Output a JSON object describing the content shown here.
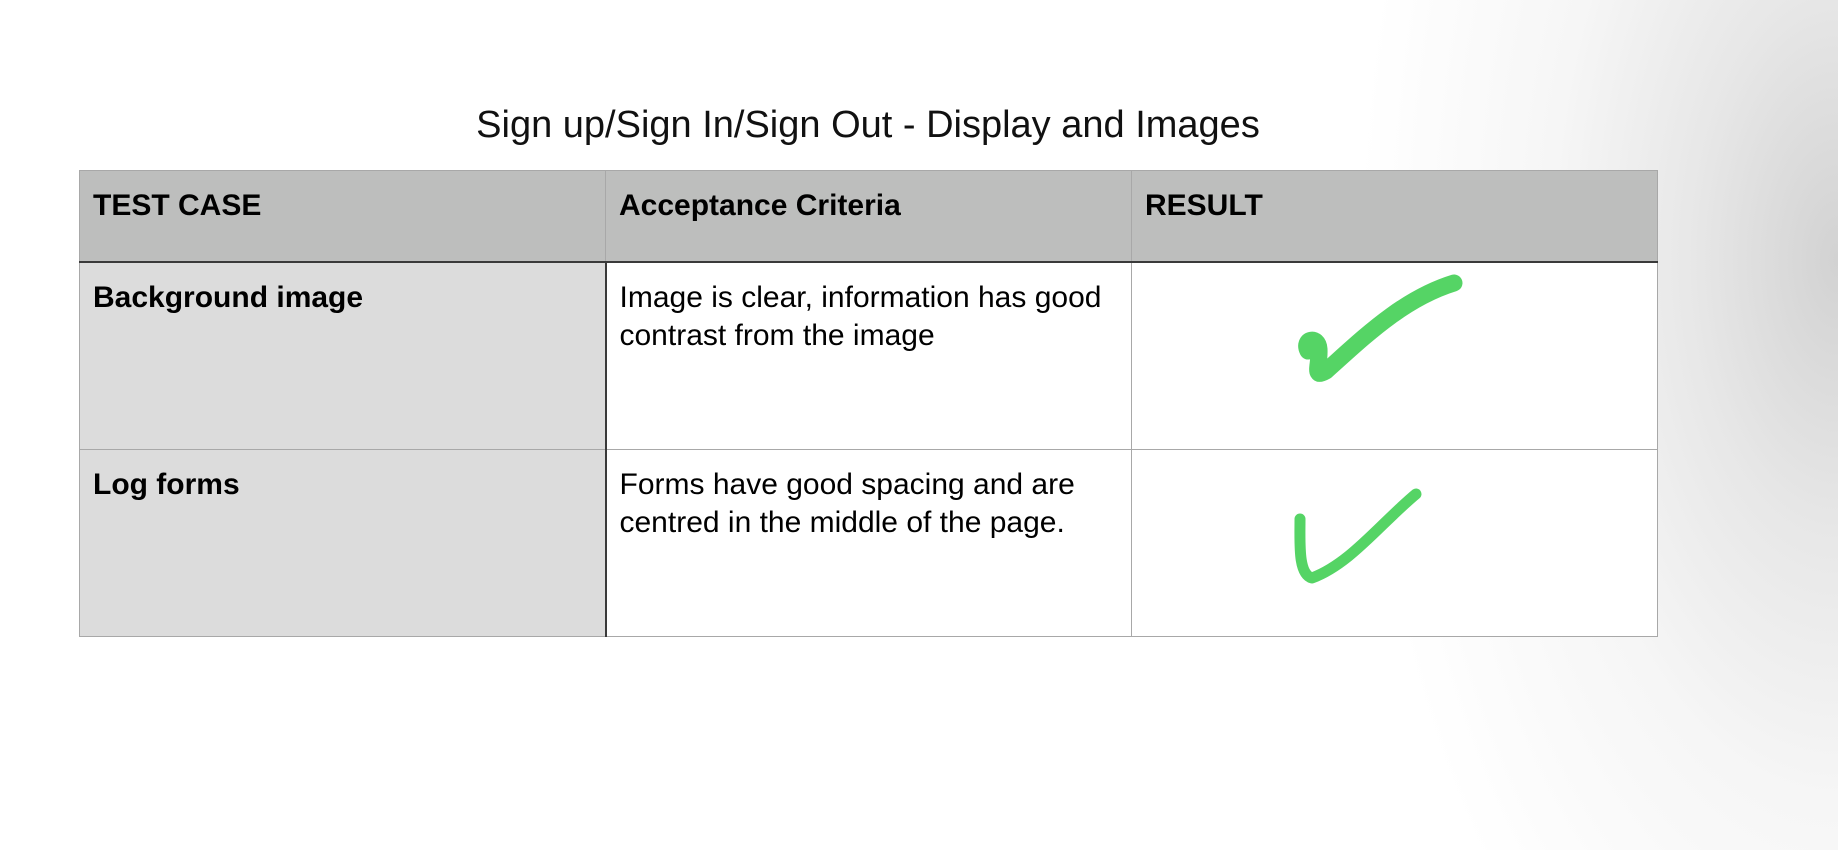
{
  "slide": {
    "title": "Sign up/Sign In/Sign Out - Display and Images"
  },
  "table": {
    "headers": [
      "TEST CASE",
      "Acceptance Criteria",
      "RESULT"
    ],
    "rows": [
      {
        "test_case": "Background image",
        "criteria": "Image is clear, information has good contrast from the image",
        "result_icon": "checkmark-icon"
      },
      {
        "test_case": "Log forms",
        "criteria": "Forms have good spacing and are centred in the middle of the page.",
        "result_icon": "checkmark-icon"
      }
    ]
  },
  "colors": {
    "header_bg": "#bdbebd",
    "case_col_bg": "#dcdcdc",
    "check": "#55d465"
  }
}
